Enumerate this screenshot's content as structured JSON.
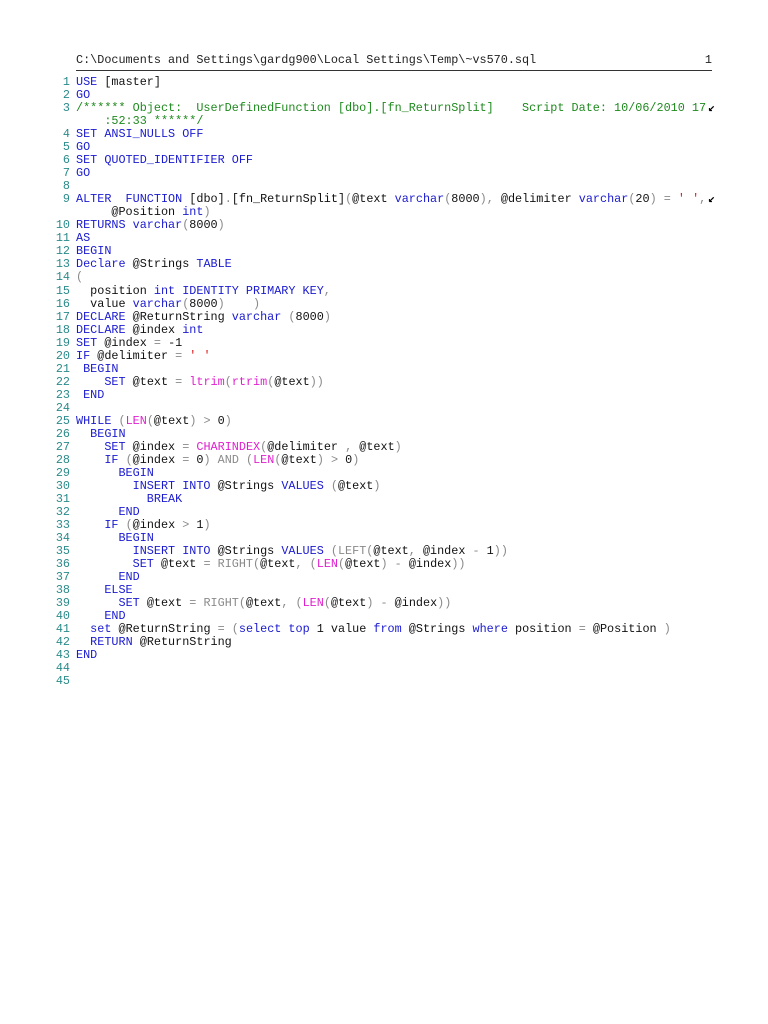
{
  "header": {
    "path": "C:\\Documents and Settings\\gardg900\\Local Settings\\Temp\\~vs570.sql",
    "page": "1"
  },
  "colors": {
    "keyword": "#1a1ad0",
    "comment": "#1f8a1f",
    "string": "#e02020",
    "function": "#e020d0",
    "operator": "#8a8a8a",
    "line_number": "#2a8a8a"
  },
  "wrap_icon": "wrap-arrow-icon",
  "lines": [
    {
      "n": "1",
      "tokens": [
        {
          "c": "k",
          "t": "USE"
        },
        {
          "c": "t",
          "t": " [master]"
        }
      ]
    },
    {
      "n": "2",
      "tokens": [
        {
          "c": "k",
          "t": "GO"
        }
      ]
    },
    {
      "n": "3",
      "tokens": [
        {
          "c": "c",
          "t": "/****** Object:  UserDefinedFunction [dbo].[fn_ReturnSplit]    Script Date: 10/06/2010 17"
        }
      ],
      "cont": {
        "indent": 4,
        "tokens": [
          {
            "c": "c",
            "t": ":52:33 ******/"
          }
        ]
      }
    },
    {
      "n": "4",
      "tokens": [
        {
          "c": "k",
          "t": "SET ANSI_NULLS OFF"
        }
      ]
    },
    {
      "n": "5",
      "tokens": [
        {
          "c": "k",
          "t": "GO"
        }
      ]
    },
    {
      "n": "6",
      "tokens": [
        {
          "c": "k",
          "t": "SET QUOTED_IDENTIFIER OFF"
        }
      ]
    },
    {
      "n": "7",
      "tokens": [
        {
          "c": "k",
          "t": "GO"
        }
      ]
    },
    {
      "n": "8",
      "tokens": []
    },
    {
      "n": "9",
      "tokens": [
        {
          "c": "k",
          "t": "ALTER  FUNCTION"
        },
        {
          "c": "t",
          "t": " [dbo]"
        },
        {
          "c": "g",
          "t": "."
        },
        {
          "c": "t",
          "t": "[fn_ReturnSplit]"
        },
        {
          "c": "g",
          "t": "("
        },
        {
          "c": "t",
          "t": "@text "
        },
        {
          "c": "k",
          "t": "varchar"
        },
        {
          "c": "g",
          "t": "("
        },
        {
          "c": "t",
          "t": "8000"
        },
        {
          "c": "g",
          "t": "),"
        },
        {
          "c": "t",
          "t": " @delimiter "
        },
        {
          "c": "k",
          "t": "varchar"
        },
        {
          "c": "g",
          "t": "("
        },
        {
          "c": "t",
          "t": "20"
        },
        {
          "c": "g",
          "t": ") = "
        },
        {
          "c": "s",
          "t": "' '"
        },
        {
          "c": "g",
          "t": ","
        }
      ],
      "cont": {
        "indent": 5,
        "tokens": [
          {
            "c": "t",
            "t": "@Position "
          },
          {
            "c": "k",
            "t": "int"
          },
          {
            "c": "g",
            "t": ")"
          }
        ]
      }
    },
    {
      "n": "10",
      "tokens": [
        {
          "c": "k",
          "t": "RETURNS varchar"
        },
        {
          "c": "g",
          "t": "("
        },
        {
          "c": "t",
          "t": "8000"
        },
        {
          "c": "g",
          "t": ")"
        }
      ]
    },
    {
      "n": "11",
      "tokens": [
        {
          "c": "k",
          "t": "AS"
        }
      ]
    },
    {
      "n": "12",
      "tokens": [
        {
          "c": "k",
          "t": "BEGIN"
        }
      ]
    },
    {
      "n": "13",
      "tokens": [
        {
          "c": "k",
          "t": "Declare"
        },
        {
          "c": "t",
          "t": " @Strings "
        },
        {
          "c": "k",
          "t": "TABLE"
        }
      ]
    },
    {
      "n": "14",
      "tokens": [
        {
          "c": "g",
          "t": "("
        }
      ]
    },
    {
      "n": "15",
      "tokens": [
        {
          "c": "t",
          "t": "  position "
        },
        {
          "c": "k",
          "t": "int IDENTITY PRIMARY KEY"
        },
        {
          "c": "g",
          "t": ","
        }
      ]
    },
    {
      "n": "16",
      "tokens": [
        {
          "c": "t",
          "t": "  value "
        },
        {
          "c": "k",
          "t": "varchar"
        },
        {
          "c": "g",
          "t": "("
        },
        {
          "c": "t",
          "t": "8000"
        },
        {
          "c": "g",
          "t": ")    )"
        }
      ]
    },
    {
      "n": "17",
      "tokens": [
        {
          "c": "k",
          "t": "DECLARE"
        },
        {
          "c": "t",
          "t": " @ReturnString "
        },
        {
          "c": "k",
          "t": "varchar"
        },
        {
          "c": "g",
          "t": " ("
        },
        {
          "c": "t",
          "t": "8000"
        },
        {
          "c": "g",
          "t": ")"
        }
      ]
    },
    {
      "n": "18",
      "tokens": [
        {
          "c": "k",
          "t": "DECLARE"
        },
        {
          "c": "t",
          "t": " @index "
        },
        {
          "c": "k",
          "t": "int"
        }
      ]
    },
    {
      "n": "19",
      "tokens": [
        {
          "c": "k",
          "t": "SET"
        },
        {
          "c": "t",
          "t": " @index "
        },
        {
          "c": "g",
          "t": "="
        },
        {
          "c": "t",
          "t": " -1"
        }
      ]
    },
    {
      "n": "20",
      "tokens": [
        {
          "c": "k",
          "t": "IF"
        },
        {
          "c": "t",
          "t": " @delimiter "
        },
        {
          "c": "g",
          "t": "= "
        },
        {
          "c": "s",
          "t": "' '"
        }
      ]
    },
    {
      "n": "21",
      "tokens": [
        {
          "c": "k",
          "t": " BEGIN"
        }
      ]
    },
    {
      "n": "22",
      "tokens": [
        {
          "c": "t",
          "t": "    "
        },
        {
          "c": "k",
          "t": "SET"
        },
        {
          "c": "t",
          "t": " @text "
        },
        {
          "c": "g",
          "t": "= "
        },
        {
          "c": "f",
          "t": "ltrim"
        },
        {
          "c": "g",
          "t": "("
        },
        {
          "c": "f",
          "t": "rtrim"
        },
        {
          "c": "g",
          "t": "("
        },
        {
          "c": "t",
          "t": "@text"
        },
        {
          "c": "g",
          "t": "))"
        }
      ]
    },
    {
      "n": "23",
      "tokens": [
        {
          "c": "k",
          "t": " END"
        }
      ]
    },
    {
      "n": "24",
      "tokens": []
    },
    {
      "n": "25",
      "tokens": [
        {
          "c": "k",
          "t": "WHILE"
        },
        {
          "c": "g",
          "t": " ("
        },
        {
          "c": "f",
          "t": "LEN"
        },
        {
          "c": "g",
          "t": "("
        },
        {
          "c": "t",
          "t": "@text"
        },
        {
          "c": "g",
          "t": ") > "
        },
        {
          "c": "t",
          "t": "0"
        },
        {
          "c": "g",
          "t": ")"
        }
      ]
    },
    {
      "n": "26",
      "tokens": [
        {
          "c": "k",
          "t": "  BEGIN"
        }
      ]
    },
    {
      "n": "27",
      "tokens": [
        {
          "c": "t",
          "t": "    "
        },
        {
          "c": "k",
          "t": "SET"
        },
        {
          "c": "t",
          "t": " @index "
        },
        {
          "c": "g",
          "t": "= "
        },
        {
          "c": "f",
          "t": "CHARINDEX"
        },
        {
          "c": "g",
          "t": "("
        },
        {
          "c": "t",
          "t": "@delimiter "
        },
        {
          "c": "g",
          "t": ", "
        },
        {
          "c": "t",
          "t": "@text"
        },
        {
          "c": "g",
          "t": ")"
        }
      ]
    },
    {
      "n": "28",
      "tokens": [
        {
          "c": "t",
          "t": "    "
        },
        {
          "c": "k",
          "t": "IF"
        },
        {
          "c": "g",
          "t": " ("
        },
        {
          "c": "t",
          "t": "@index "
        },
        {
          "c": "g",
          "t": "= "
        },
        {
          "c": "t",
          "t": "0"
        },
        {
          "c": "g",
          "t": ") AND ("
        },
        {
          "c": "f",
          "t": "LEN"
        },
        {
          "c": "g",
          "t": "("
        },
        {
          "c": "t",
          "t": "@text"
        },
        {
          "c": "g",
          "t": ") > "
        },
        {
          "c": "t",
          "t": "0"
        },
        {
          "c": "g",
          "t": ")"
        }
      ]
    },
    {
      "n": "29",
      "tokens": [
        {
          "c": "k",
          "t": "      BEGIN"
        }
      ]
    },
    {
      "n": "30",
      "tokens": [
        {
          "c": "t",
          "t": "        "
        },
        {
          "c": "k",
          "t": "INSERT INTO"
        },
        {
          "c": "t",
          "t": " @Strings "
        },
        {
          "c": "k",
          "t": "VALUES"
        },
        {
          "c": "g",
          "t": " ("
        },
        {
          "c": "t",
          "t": "@text"
        },
        {
          "c": "g",
          "t": ")"
        }
      ]
    },
    {
      "n": "31",
      "tokens": [
        {
          "c": "k",
          "t": "          BREAK"
        }
      ]
    },
    {
      "n": "32",
      "tokens": [
        {
          "c": "k",
          "t": "      END"
        }
      ]
    },
    {
      "n": "33",
      "tokens": [
        {
          "c": "t",
          "t": "    "
        },
        {
          "c": "k",
          "t": "IF"
        },
        {
          "c": "g",
          "t": " ("
        },
        {
          "c": "t",
          "t": "@index "
        },
        {
          "c": "g",
          "t": "> "
        },
        {
          "c": "t",
          "t": "1"
        },
        {
          "c": "g",
          "t": ")"
        }
      ]
    },
    {
      "n": "34",
      "tokens": [
        {
          "c": "k",
          "t": "      BEGIN"
        }
      ]
    },
    {
      "n": "35",
      "tokens": [
        {
          "c": "t",
          "t": "        "
        },
        {
          "c": "k",
          "t": "INSERT INTO"
        },
        {
          "c": "t",
          "t": " @Strings "
        },
        {
          "c": "k",
          "t": "VALUES"
        },
        {
          "c": "g",
          "t": " (LEFT("
        },
        {
          "c": "t",
          "t": "@text"
        },
        {
          "c": "g",
          "t": ", "
        },
        {
          "c": "t",
          "t": "@index "
        },
        {
          "c": "g",
          "t": "- "
        },
        {
          "c": "t",
          "t": "1"
        },
        {
          "c": "g",
          "t": "))"
        }
      ]
    },
    {
      "n": "36",
      "tokens": [
        {
          "c": "t",
          "t": "        "
        },
        {
          "c": "k",
          "t": "SET"
        },
        {
          "c": "t",
          "t": " @text "
        },
        {
          "c": "g",
          "t": "= RIGHT("
        },
        {
          "c": "t",
          "t": "@text"
        },
        {
          "c": "g",
          "t": ", ("
        },
        {
          "c": "f",
          "t": "LEN"
        },
        {
          "c": "g",
          "t": "("
        },
        {
          "c": "t",
          "t": "@text"
        },
        {
          "c": "g",
          "t": ") - "
        },
        {
          "c": "t",
          "t": "@index"
        },
        {
          "c": "g",
          "t": "))"
        }
      ]
    },
    {
      "n": "37",
      "tokens": [
        {
          "c": "k",
          "t": "      END"
        }
      ]
    },
    {
      "n": "38",
      "tokens": [
        {
          "c": "k",
          "t": "    ELSE"
        }
      ]
    },
    {
      "n": "39",
      "tokens": [
        {
          "c": "t",
          "t": "      "
        },
        {
          "c": "k",
          "t": "SET"
        },
        {
          "c": "t",
          "t": " @text "
        },
        {
          "c": "g",
          "t": "= RIGHT("
        },
        {
          "c": "t",
          "t": "@text"
        },
        {
          "c": "g",
          "t": ", ("
        },
        {
          "c": "f",
          "t": "LEN"
        },
        {
          "c": "g",
          "t": "("
        },
        {
          "c": "t",
          "t": "@text"
        },
        {
          "c": "g",
          "t": ") - "
        },
        {
          "c": "t",
          "t": "@index"
        },
        {
          "c": "g",
          "t": "))"
        }
      ]
    },
    {
      "n": "40",
      "tokens": [
        {
          "c": "k",
          "t": "    END"
        }
      ]
    },
    {
      "n": "41",
      "tokens": [
        {
          "c": "t",
          "t": "  "
        },
        {
          "c": "k",
          "t": "set"
        },
        {
          "c": "t",
          "t": " @ReturnString "
        },
        {
          "c": "g",
          "t": "= ("
        },
        {
          "c": "k",
          "t": "select top"
        },
        {
          "c": "t",
          "t": " 1 value "
        },
        {
          "c": "k",
          "t": "from"
        },
        {
          "c": "t",
          "t": " @Strings "
        },
        {
          "c": "k",
          "t": "where"
        },
        {
          "c": "t",
          "t": " position "
        },
        {
          "c": "g",
          "t": "= "
        },
        {
          "c": "t",
          "t": "@Position "
        },
        {
          "c": "g",
          "t": ")"
        }
      ]
    },
    {
      "n": "42",
      "tokens": [
        {
          "c": "t",
          "t": "  "
        },
        {
          "c": "k",
          "t": "RETURN"
        },
        {
          "c": "t",
          "t": " @ReturnString"
        }
      ]
    },
    {
      "n": "43",
      "tokens": [
        {
          "c": "k",
          "t": "END"
        }
      ]
    },
    {
      "n": "44",
      "tokens": []
    },
    {
      "n": "45",
      "tokens": []
    }
  ]
}
